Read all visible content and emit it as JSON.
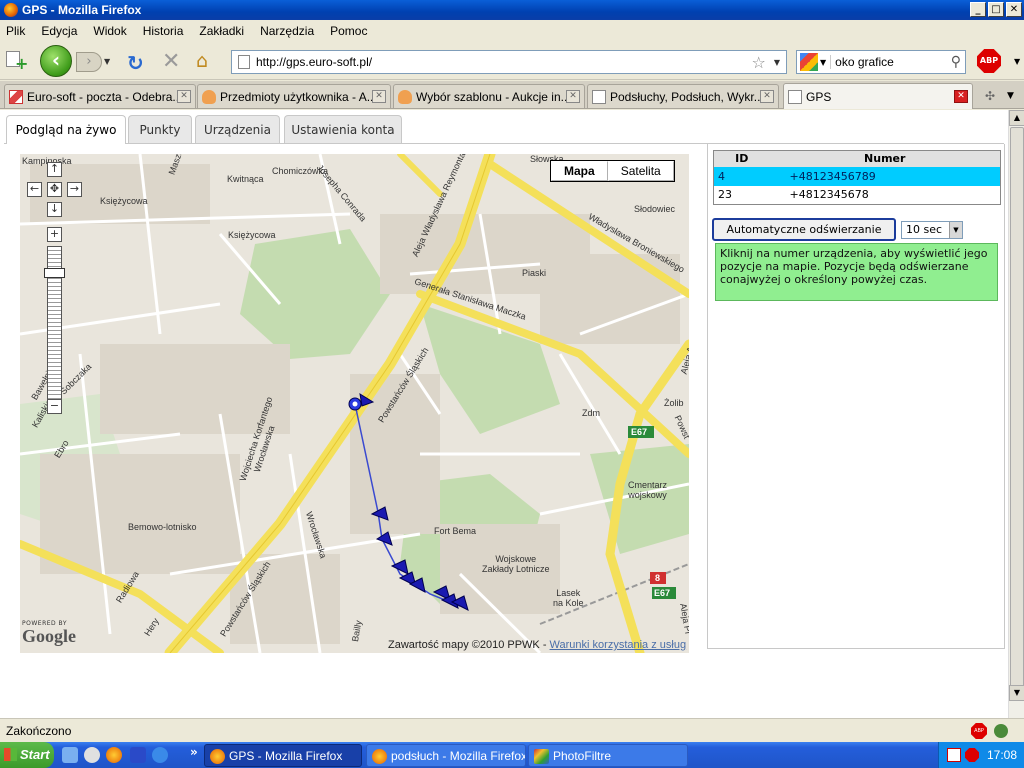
{
  "window": {
    "title": "GPS - Mozilla Firefox",
    "controls": [
      "_",
      "□",
      "✕"
    ]
  },
  "menu": [
    "Plik",
    "Edycja",
    "Widok",
    "Historia",
    "Zakładki",
    "Narzędzia",
    "Pomoc"
  ],
  "nav": {
    "url": "http://gps.euro-soft.pl/",
    "search_query": "oko grafice",
    "abp_label": "ABP"
  },
  "browser_tabs": [
    {
      "label": "Euro-soft - poczta - Odebra...",
      "icon": "gmail-icon"
    },
    {
      "label": "Przedmioty użytkownika - A...",
      "icon": "allegro-icon"
    },
    {
      "label": "Wybór szablonu - Aukcje in...",
      "icon": "allegro-icon"
    },
    {
      "label": "Podsłuchy, Podsłuch, Wykr...",
      "icon": "page-icon"
    },
    {
      "label": "GPS",
      "icon": "page-icon",
      "active": true
    }
  ],
  "app_tabs": [
    "Podgląd na żywo",
    "Punkty",
    "Urządzenia",
    "Ustawienia konta"
  ],
  "map": {
    "type_buttons": [
      "Mapa",
      "Satelita"
    ],
    "selected_type": "Mapa",
    "powered_by": "POWERED BY",
    "logo": "Google",
    "copyright_text": "Zawartość mapy ©2010 PPWK - ",
    "terms_link": "Warunki korzystania z usług",
    "labels": {
      "kampinoska": "Kampinoska",
      "maszewska": "Maszewska",
      "kwitnaca": "Kwitnąca",
      "chomiczowka": "Chomiczówka",
      "ksiezycowa1": "Księżycowa",
      "ksiezycowa2": "Księżycowa",
      "conrada": "Josepha Conrada",
      "reymonta": "Aleja Władysława Reymonta",
      "broniewskiego": "Władysława Broniewskiego",
      "maczka": "Generała Stanisława Maczka",
      "piaski": "Piaski",
      "slodowiec": "Słodowiec",
      "slaskich1": "Powstańców Śląskich",
      "slaskich2": "Powstańców Śląskich",
      "slaskich3": "Powstańców Śląskich",
      "zdm": "Zdm",
      "zolib": "Żolib",
      "e67a": "E67",
      "e67b": "E67",
      "cmentarz": "Cmentarz\nwojskowy",
      "bemowo": "Bemowo-lotnisko",
      "fort_bema": "Fort Bema",
      "zaklady": "Wojskowe\nZakłady Lotnicze",
      "lasek": "Lasek\nna Kole",
      "radiowa": "Radiowa",
      "ebro": "Ebro",
      "sobczaka": "Sobczaka",
      "kaliskiego": "Kaliskiego",
      "bawelniana": "Bawełniana",
      "korfantego": "Wojciecha Korfantego",
      "wroclawska1": "Wrocławska",
      "wroclawska2": "Wrocławska",
      "hery": "Hery",
      "bailly": "Bailly",
      "aleja_ar": "Aleja Ar",
      "aleja_pr": "Aleja Pr",
      "r8": "8",
      "powst": "Powst",
      "slowska": "Słowska"
    }
  },
  "devices": {
    "headers": [
      "ID",
      "Numer"
    ],
    "rows": [
      {
        "id": "4",
        "number": "+48123456789",
        "selected": true
      },
      {
        "id": "23",
        "number": "+4812345678",
        "selected": false
      }
    ]
  },
  "refresh": {
    "button_label": "Automatyczne odświerzanie",
    "interval": "10 sec"
  },
  "info_text": "Kliknij na numer urządzenia, aby wyświetlić jego pozycje na mapie. Pozycje będą odświerzane conajwyżej o określony powyżej czas.",
  "status": "Zakończono",
  "taskbar": {
    "start": "Start",
    "tasks": [
      {
        "label": "GPS - Mozilla Firefox",
        "active": true
      },
      {
        "label": "podsłuch - Mozilla Firefox",
        "active": false
      },
      {
        "label": "PhotoFiltre",
        "active": false
      }
    ],
    "clock": "17:08"
  }
}
